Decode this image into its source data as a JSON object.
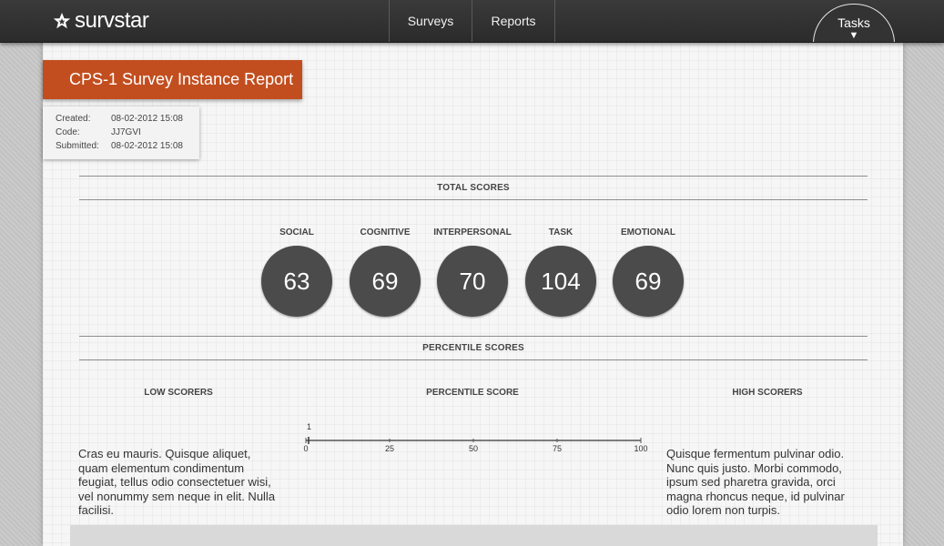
{
  "brand": {
    "name": "survstar",
    "icon": "star-icon"
  },
  "nav": {
    "surveys": "Surveys",
    "reports": "Reports",
    "tasks": "Tasks",
    "tasks_caret": "▼"
  },
  "report": {
    "title": "CPS-1 Survey Instance Report",
    "meta": [
      {
        "key": "Created:",
        "value": "08-02-2012 15:08"
      },
      {
        "key": "Code:",
        "value": "JJ7GVI"
      },
      {
        "key": "Submitted:",
        "value": "08-02-2012 15:08"
      }
    ]
  },
  "total_scores": {
    "heading": "TOTAL SCORES",
    "items": [
      {
        "label": "SOCIAL",
        "value": "63"
      },
      {
        "label": "COGNITIVE",
        "value": "69"
      },
      {
        "label": "INTERPERSONAL",
        "value": "70"
      },
      {
        "label": "TASK",
        "value": "104"
      },
      {
        "label": "EMOTIONAL",
        "value": "69"
      }
    ]
  },
  "percentile": {
    "heading": "PERCENTILE SCORES",
    "low_heading": "LOW SCORERS",
    "score_heading": "PERCENTILE SCORE",
    "high_heading": "HIGH SCORERS",
    "low_text": "Cras eu mauris. Quisque aliquet, quam elementum condimentum feugiat, tellus odio consectetuer wisi, vel nonummy sem neque in elit. Nulla facilisi.",
    "high_text": "Quisque fermentum pulvinar odio. Nunc quis justo. Morbi commodo, ipsum sed pharetra gravida, orci magna rhoncus neque, id pulvinar odio lorem non turpis.",
    "marker_value": "1",
    "axis_ticks": [
      "0",
      "25",
      "50",
      "75",
      "100"
    ]
  },
  "colors": {
    "accent": "#c24e1f",
    "circle": "#4b4b4b",
    "navbar": "#2f2f2f"
  }
}
